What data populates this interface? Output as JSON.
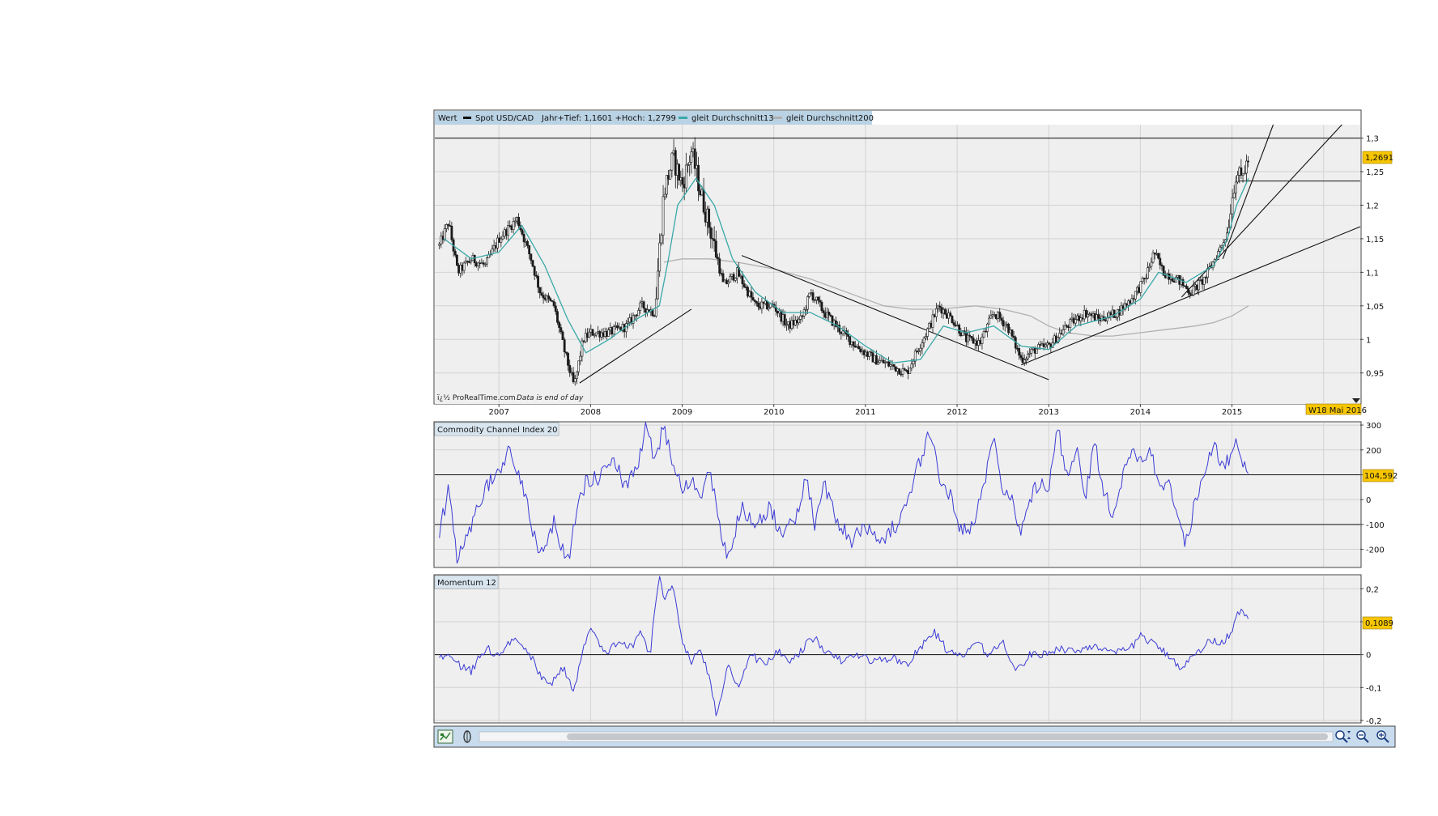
{
  "header": {
    "wert_label": "Wert",
    "series_label": "Spot USD/CAD",
    "range_label": "Jahr+Tief: 1,1601 +Hoch: 1,2799",
    "ma13_label": "gleit Durchschnitt13",
    "ma200_label": "gleit Durchschnitt200"
  },
  "credit": {
    "source_text": "ï¿½ ProRealTime.com",
    "note_text": "Data is end of day"
  },
  "date_marker": "W18 Mai 2016",
  "colors": {
    "panel_bg": "#efefef",
    "header_bar": "#b9d2e4",
    "grid": "#d2d2d2",
    "candle": "#1a1a1a",
    "ma13": "#3aa8a8",
    "ma200": "#b0b0b0",
    "oscillator": "#3b3bd6",
    "value_badge": "#f7c600",
    "toolbar_bg": "#c8dced"
  },
  "toolbar": {
    "icons": [
      "chart-settings-icon",
      "indicator-icon",
      "zoom-fit-icon",
      "zoom-out-icon",
      "zoom-in-icon"
    ]
  },
  "chart_data": [
    {
      "type": "candlestick",
      "title": "Spot USD/CAD",
      "x_ticks": [
        "2007",
        "2008",
        "2009",
        "2010",
        "2011",
        "2012",
        "2013",
        "2014",
        "2015"
      ],
      "x_range": [
        2006.3,
        2016.4
      ],
      "y_ticks": [
        "1,3",
        "1,25",
        "1,2",
        "1,15",
        "1,1",
        "1,05",
        "1",
        "0,95"
      ],
      "ylim": [
        0.905,
        1.32
      ],
      "last_value": "1,2691",
      "last_value_num": 1.2691,
      "price_path": [
        [
          2006.35,
          1.14
        ],
        [
          2006.45,
          1.175
        ],
        [
          2006.55,
          1.1
        ],
        [
          2006.7,
          1.12
        ],
        [
          2006.85,
          1.11
        ],
        [
          2007.0,
          1.15
        ],
        [
          2007.1,
          1.165
        ],
        [
          2007.2,
          1.18
        ],
        [
          2007.35,
          1.12
        ],
        [
          2007.45,
          1.07
        ],
        [
          2007.6,
          1.05
        ],
        [
          2007.72,
          0.98
        ],
        [
          2007.82,
          0.93
        ],
        [
          2007.92,
          1.0
        ],
        [
          2008.0,
          1.01
        ],
        [
          2008.2,
          1.01
        ],
        [
          2008.4,
          1.02
        ],
        [
          2008.55,
          1.05
        ],
        [
          2008.7,
          1.04
        ],
        [
          2008.8,
          1.22
        ],
        [
          2008.9,
          1.27
        ],
        [
          2009.0,
          1.23
        ],
        [
          2009.1,
          1.28
        ],
        [
          2009.2,
          1.22
        ],
        [
          2009.35,
          1.14
        ],
        [
          2009.45,
          1.08
        ],
        [
          2009.6,
          1.1
        ],
        [
          2009.8,
          1.05
        ],
        [
          2010.0,
          1.05
        ],
        [
          2010.15,
          1.02
        ],
        [
          2010.3,
          1.03
        ],
        [
          2010.4,
          1.07
        ],
        [
          2010.55,
          1.04
        ],
        [
          2010.75,
          1.01
        ],
        [
          2010.9,
          0.99
        ],
        [
          2011.1,
          0.97
        ],
        [
          2011.3,
          0.96
        ],
        [
          2011.45,
          0.95
        ],
        [
          2011.55,
          0.98
        ],
        [
          2011.7,
          1.02
        ],
        [
          2011.8,
          1.05
        ],
        [
          2011.95,
          1.03
        ],
        [
          2012.1,
          1.0
        ],
        [
          2012.25,
          0.995
        ],
        [
          2012.4,
          1.04
        ],
        [
          2012.55,
          1.02
        ],
        [
          2012.7,
          0.97
        ],
        [
          2012.85,
          0.985
        ],
        [
          2013.0,
          0.99
        ],
        [
          2013.2,
          1.02
        ],
        [
          2013.4,
          1.04
        ],
        [
          2013.55,
          1.03
        ],
        [
          2013.75,
          1.04
        ],
        [
          2013.9,
          1.06
        ],
        [
          2014.05,
          1.09
        ],
        [
          2014.15,
          1.13
        ],
        [
          2014.25,
          1.1
        ],
        [
          2014.4,
          1.09
        ],
        [
          2014.55,
          1.07
        ],
        [
          2014.7,
          1.09
        ],
        [
          2014.85,
          1.13
        ],
        [
          2014.95,
          1.16
        ],
        [
          2015.0,
          1.21
        ],
        [
          2015.05,
          1.25
        ],
        [
          2015.1,
          1.24
        ],
        [
          2015.18,
          1.269
        ]
      ],
      "ma13_path": [
        [
          2006.4,
          1.15
        ],
        [
          2006.7,
          1.12
        ],
        [
          2007.0,
          1.13
        ],
        [
          2007.25,
          1.17
        ],
        [
          2007.5,
          1.11
        ],
        [
          2007.75,
          1.03
        ],
        [
          2007.95,
          0.98
        ],
        [
          2008.2,
          1.0
        ],
        [
          2008.5,
          1.03
        ],
        [
          2008.75,
          1.05
        ],
        [
          2008.85,
          1.12
        ],
        [
          2008.95,
          1.2
        ],
        [
          2009.15,
          1.24
        ],
        [
          2009.35,
          1.2
        ],
        [
          2009.55,
          1.12
        ],
        [
          2009.8,
          1.07
        ],
        [
          2010.1,
          1.04
        ],
        [
          2010.4,
          1.04
        ],
        [
          2010.7,
          1.02
        ],
        [
          2011.0,
          0.99
        ],
        [
          2011.3,
          0.965
        ],
        [
          2011.6,
          0.97
        ],
        [
          2011.85,
          1.02
        ],
        [
          2012.1,
          1.01
        ],
        [
          2012.4,
          1.02
        ],
        [
          2012.7,
          0.99
        ],
        [
          2013.0,
          0.985
        ],
        [
          2013.3,
          1.02
        ],
        [
          2013.7,
          1.035
        ],
        [
          2014.0,
          1.06
        ],
        [
          2014.2,
          1.1
        ],
        [
          2014.5,
          1.085
        ],
        [
          2014.8,
          1.11
        ],
        [
          2014.95,
          1.15
        ],
        [
          2015.05,
          1.2
        ],
        [
          2015.18,
          1.24
        ]
      ],
      "ma200_path": [
        [
          2008.8,
          1.115
        ],
        [
          2009.0,
          1.12
        ],
        [
          2009.3,
          1.12
        ],
        [
          2009.6,
          1.115
        ],
        [
          2010.0,
          1.105
        ],
        [
          2010.4,
          1.09
        ],
        [
          2010.8,
          1.07
        ],
        [
          2011.2,
          1.05
        ],
        [
          2011.5,
          1.045
        ],
        [
          2011.8,
          1.045
        ],
        [
          2012.2,
          1.05
        ],
        [
          2012.5,
          1.045
        ],
        [
          2012.8,
          1.035
        ],
        [
          2013.0,
          1.02
        ],
        [
          2013.2,
          1.01
        ],
        [
          2013.5,
          1.005
        ],
        [
          2013.7,
          1.005
        ],
        [
          2014.0,
          1.01
        ],
        [
          2014.3,
          1.015
        ],
        [
          2014.6,
          1.02
        ],
        [
          2014.8,
          1.025
        ],
        [
          2015.0,
          1.035
        ],
        [
          2015.18,
          1.05
        ]
      ],
      "horizontal_lines": [
        1.3,
        1.236
      ],
      "trend_lines": [
        [
          [
            2007.88,
            0.935
          ],
          [
            2009.1,
            1.045
          ]
        ],
        [
          [
            2009.65,
            1.125
          ],
          [
            2013.0,
            0.94
          ]
        ],
        [
          [
            2012.7,
            0.962
          ],
          [
            2016.4,
            1.168
          ]
        ],
        [
          [
            2014.45,
            1.063
          ],
          [
            2016.2,
            1.32
          ]
        ],
        [
          [
            2014.9,
            1.12
          ],
          [
            2015.45,
            1.32
          ]
        ]
      ]
    },
    {
      "type": "line",
      "title": "Commodity Channel Index 20",
      "series": [
        {
          "name": "Commodity Channel Index 20"
        }
      ],
      "x_range": [
        2006.3,
        2016.4
      ],
      "y_ticks": [
        "300",
        "200",
        "100",
        "0",
        "-100",
        "-200"
      ],
      "ylim": [
        -270,
        310
      ],
      "reference_lines": [
        100,
        -100
      ],
      "last_value": "104,592",
      "last_value_num": 104.592,
      "anchors": [
        [
          2006.35,
          -140
        ],
        [
          2006.45,
          50
        ],
        [
          2006.55,
          -250
        ],
        [
          2006.7,
          -100
        ],
        [
          2006.85,
          40
        ],
        [
          2007.0,
          120
        ],
        [
          2007.1,
          190
        ],
        [
          2007.25,
          80
        ],
        [
          2007.35,
          -100
        ],
        [
          2007.45,
          -210
        ],
        [
          2007.6,
          -90
        ],
        [
          2007.75,
          -250
        ],
        [
          2007.85,
          -50
        ],
        [
          2007.95,
          70
        ],
        [
          2008.1,
          90
        ],
        [
          2008.25,
          160
        ],
        [
          2008.4,
          40
        ],
        [
          2008.55,
          180
        ],
        [
          2008.6,
          320
        ],
        [
          2008.7,
          140
        ],
        [
          2008.8,
          300
        ],
        [
          2008.9,
          150
        ],
        [
          2009.0,
          50
        ],
        [
          2009.1,
          90
        ],
        [
          2009.2,
          0
        ],
        [
          2009.3,
          120
        ],
        [
          2009.4,
          -100
        ],
        [
          2009.5,
          -220
        ],
        [
          2009.65,
          -30
        ],
        [
          2009.8,
          -110
        ],
        [
          2009.95,
          -40
        ],
        [
          2010.1,
          -140
        ],
        [
          2010.25,
          -60
        ],
        [
          2010.35,
          80
        ],
        [
          2010.45,
          -100
        ],
        [
          2010.55,
          60
        ],
        [
          2010.7,
          -90
        ],
        [
          2010.85,
          -160
        ],
        [
          2011.0,
          -110
        ],
        [
          2011.2,
          -150
        ],
        [
          2011.35,
          -100
        ],
        [
          2011.45,
          -40
        ],
        [
          2011.55,
          100
        ],
        [
          2011.7,
          280
        ],
        [
          2011.8,
          100
        ],
        [
          2011.95,
          0
        ],
        [
          2012.05,
          -130
        ],
        [
          2012.2,
          -90
        ],
        [
          2012.3,
          80
        ],
        [
          2012.4,
          260
        ],
        [
          2012.5,
          50
        ],
        [
          2012.6,
          0
        ],
        [
          2012.7,
          -140
        ],
        [
          2012.8,
          10
        ],
        [
          2012.9,
          80
        ],
        [
          2013.0,
          60
        ],
        [
          2013.1,
          280
        ],
        [
          2013.2,
          100
        ],
        [
          2013.3,
          200
        ],
        [
          2013.4,
          0
        ],
        [
          2013.5,
          230
        ],
        [
          2013.6,
          40
        ],
        [
          2013.7,
          -60
        ],
        [
          2013.8,
          80
        ],
        [
          2013.9,
          200
        ],
        [
          2014.0,
          140
        ],
        [
          2014.1,
          210
        ],
        [
          2014.2,
          50
        ],
        [
          2014.3,
          80
        ],
        [
          2014.4,
          -60
        ],
        [
          2014.5,
          -180
        ],
        [
          2014.6,
          0
        ],
        [
          2014.7,
          100
        ],
        [
          2014.8,
          220
        ],
        [
          2014.9,
          130
        ],
        [
          2015.0,
          180
        ],
        [
          2015.05,
          240
        ],
        [
          2015.12,
          130
        ],
        [
          2015.18,
          104.592
        ]
      ]
    },
    {
      "type": "line",
      "title": "Momentum 12",
      "series": [
        {
          "name": "Momentum 12"
        }
      ],
      "x_range": [
        2006.3,
        2016.4
      ],
      "y_ticks": [
        "0,2",
        "0,1",
        "0",
        "-0,1",
        "-0,2"
      ],
      "ylim": [
        -0.205,
        0.24
      ],
      "reference_lines": [
        0
      ],
      "last_value": "0,1089",
      "last_value_num": 0.1089,
      "anchors": [
        [
          2006.35,
          -0.01
        ],
        [
          2006.45,
          0.01
        ],
        [
          2006.55,
          -0.03
        ],
        [
          2006.7,
          -0.05
        ],
        [
          2006.85,
          0.02
        ],
        [
          2007.0,
          0.0
        ],
        [
          2007.1,
          0.03
        ],
        [
          2007.2,
          0.05
        ],
        [
          2007.3,
          0.02
        ],
        [
          2007.45,
          -0.06
        ],
        [
          2007.55,
          -0.1
        ],
        [
          2007.7,
          -0.04
        ],
        [
          2007.82,
          -0.11
        ],
        [
          2007.95,
          0.05
        ],
        [
          2008.0,
          0.08
        ],
        [
          2008.15,
          0.0
        ],
        [
          2008.3,
          0.04
        ],
        [
          2008.45,
          0.02
        ],
        [
          2008.55,
          0.07
        ],
        [
          2008.65,
          0.0
        ],
        [
          2008.75,
          0.25
        ],
        [
          2008.8,
          0.16
        ],
        [
          2008.9,
          0.22
        ],
        [
          2009.0,
          0.04
        ],
        [
          2009.1,
          -0.02
        ],
        [
          2009.2,
          0.02
        ],
        [
          2009.3,
          -0.08
        ],
        [
          2009.38,
          -0.19
        ],
        [
          2009.5,
          -0.02
        ],
        [
          2009.6,
          -0.1
        ],
        [
          2009.75,
          0.0
        ],
        [
          2009.9,
          -0.03
        ],
        [
          2010.05,
          0.01
        ],
        [
          2010.2,
          -0.02
        ],
        [
          2010.35,
          0.03
        ],
        [
          2010.45,
          0.05
        ],
        [
          2010.6,
          0.0
        ],
        [
          2010.75,
          -0.02
        ],
        [
          2010.9,
          0.0
        ],
        [
          2011.1,
          -0.02
        ],
        [
          2011.3,
          -0.01
        ],
        [
          2011.45,
          -0.03
        ],
        [
          2011.6,
          0.02
        ],
        [
          2011.75,
          0.07
        ],
        [
          2011.9,
          0.01
        ],
        [
          2012.05,
          -0.01
        ],
        [
          2012.2,
          0.04
        ],
        [
          2012.35,
          0.0
        ],
        [
          2012.5,
          0.04
        ],
        [
          2012.65,
          -0.05
        ],
        [
          2012.8,
          0.0
        ],
        [
          2012.95,
          0.0
        ],
        [
          2013.1,
          0.02
        ],
        [
          2013.3,
          0.01
        ],
        [
          2013.5,
          0.03
        ],
        [
          2013.7,
          0.0
        ],
        [
          2013.9,
          0.02
        ],
        [
          2014.0,
          0.06
        ],
        [
          2014.15,
          0.03
        ],
        [
          2014.3,
          0.0
        ],
        [
          2014.45,
          -0.04
        ],
        [
          2014.6,
          0.0
        ],
        [
          2014.75,
          0.04
        ],
        [
          2014.9,
          0.04
        ],
        [
          2015.0,
          0.07
        ],
        [
          2015.06,
          0.14
        ],
        [
          2015.12,
          0.12
        ],
        [
          2015.18,
          0.1089
        ]
      ]
    }
  ]
}
